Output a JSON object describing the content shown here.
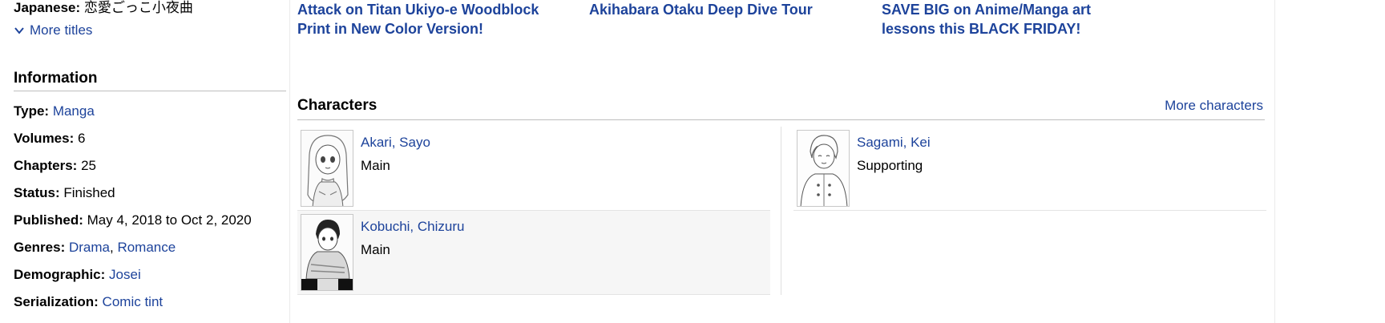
{
  "sidebar": {
    "alt_title": {
      "label": "Japanese:",
      "value": "恋愛ごっこ小夜曲"
    },
    "more_titles_label": "More titles",
    "information_heading": "Information",
    "info": [
      {
        "label": "Type:",
        "links": [
          "Manga"
        ]
      },
      {
        "label": "Volumes:",
        "value": "6"
      },
      {
        "label": "Chapters:",
        "value": "25"
      },
      {
        "label": "Status:",
        "value": "Finished"
      },
      {
        "label": "Published:",
        "value": "May 4, 2018 to Oct 2, 2020"
      },
      {
        "label": "Genres:",
        "links": [
          "Drama",
          "Romance"
        ]
      },
      {
        "label": "Demographic:",
        "links": [
          "Josei"
        ]
      },
      {
        "label": "Serialization:",
        "links": [
          "Comic tint"
        ]
      }
    ]
  },
  "promos": [
    "Attack on Titan Ukiyo-e Woodblock Print in New Color Version!",
    "Akihabara Otaku Deep Dive Tour",
    "SAVE BIG on Anime/Manga art lessons this BLACK FRIDAY!"
  ],
  "characters": {
    "heading": "Characters",
    "more_label": "More characters",
    "left": [
      {
        "name": "Akari, Sayo",
        "role": "Main"
      },
      {
        "name": "Kobuchi, Chizuru",
        "role": "Main"
      }
    ],
    "right": [
      {
        "name": "Sagami, Kei",
        "role": "Supporting"
      }
    ]
  },
  "colors": {
    "link": "#1d439b",
    "divider": "#bebebe",
    "row_shade": "#f6f6f6"
  }
}
